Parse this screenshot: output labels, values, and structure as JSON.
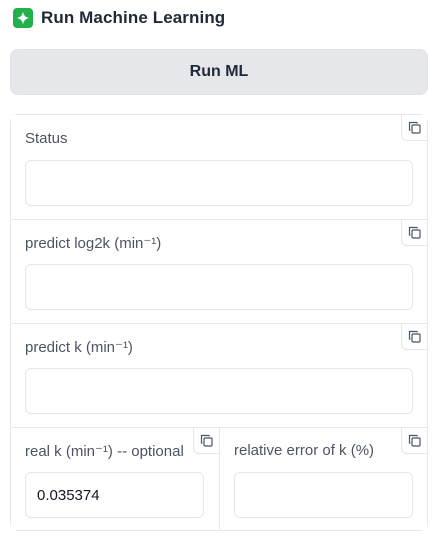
{
  "header": {
    "title": "Run Machine Learning",
    "icon": "sparkle-icon",
    "icon_color": "#23b04a"
  },
  "run_button": {
    "label": "Run ML"
  },
  "outputs": {
    "status": {
      "label": "Status",
      "value": ""
    },
    "predict_log2k": {
      "label": "predict log2k (min⁻¹)",
      "value": ""
    },
    "predict_k": {
      "label": "predict k (min⁻¹)",
      "value": ""
    },
    "real_k": {
      "label": "real k (min⁻¹) -- optional",
      "value": "0.035374"
    },
    "relative_error": {
      "label": "relative error of k (%)",
      "value": ""
    }
  },
  "icons": {
    "copy": "copy-icon"
  }
}
